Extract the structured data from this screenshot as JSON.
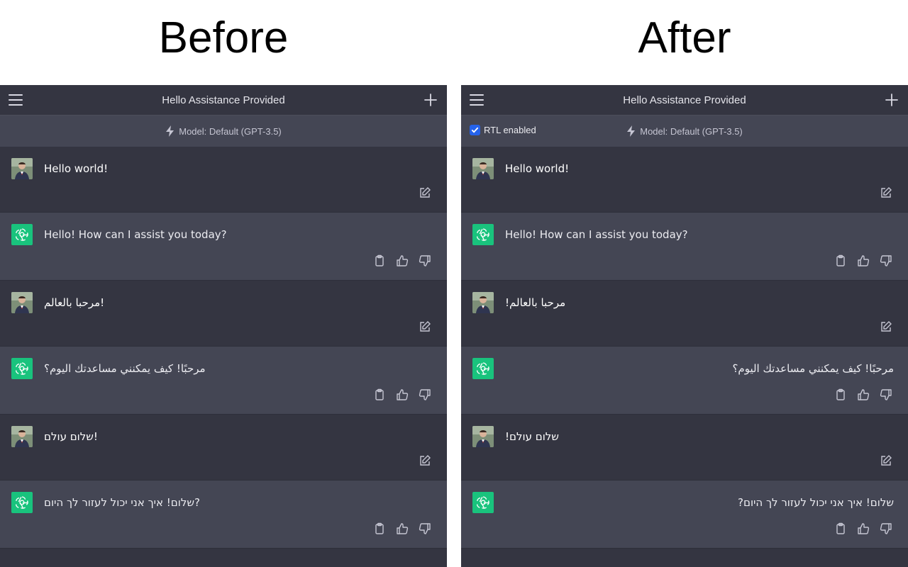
{
  "headings": {
    "before": "Before",
    "after": "After"
  },
  "panels": [
    {
      "id": "before",
      "title": "Hello Assistance Provided",
      "model": "Model: Default (GPT-3.5)",
      "rtl_toggle": null,
      "messages": [
        {
          "role": "user",
          "text": "Hello world!",
          "rtl": false
        },
        {
          "role": "assistant",
          "text": "Hello! How can I assist you today?",
          "rtl": false
        },
        {
          "role": "user",
          "text": "مرحبا بالعالم!",
          "rtl": false
        },
        {
          "role": "assistant",
          "text": "مرحبًا! كيف يمكنني مساعدتك اليوم؟",
          "rtl": false
        },
        {
          "role": "user",
          "text": "שלום עולם!",
          "rtl": false
        },
        {
          "role": "assistant",
          "text": "שלום! איך אני יכול לעזור לך היום?",
          "rtl": false
        }
      ]
    },
    {
      "id": "after",
      "title": "Hello Assistance Provided",
      "model": "Model: Default (GPT-3.5)",
      "rtl_toggle": "RTL enabled",
      "messages": [
        {
          "role": "user",
          "text": "Hello world!",
          "rtl": false
        },
        {
          "role": "assistant",
          "text": "Hello! How can I assist you today?",
          "rtl": false
        },
        {
          "role": "user",
          "text": "مرحبا بالعالم!",
          "rtl": true
        },
        {
          "role": "assistant",
          "text": "مرحبًا! كيف يمكنني مساعدتك اليوم؟",
          "rtl": true
        },
        {
          "role": "user",
          "text": "שלום עולם!",
          "rtl": true
        },
        {
          "role": "assistant",
          "text": "שלום! איך אני יכול לעזור לך היום?",
          "rtl": true
        }
      ]
    }
  ],
  "colors": {
    "background": "#343541",
    "assistant_row": "#444654",
    "gpt_avatar": "#19c37d",
    "rtl_checkbox": "#2563eb"
  },
  "icons": {
    "menu": "hamburger-menu-icon",
    "new_chat": "plus-icon",
    "model": "lightning-bolt-icon",
    "edit": "edit-pencil-icon",
    "copy": "clipboard-icon",
    "thumbs_up": "thumbs-up-icon",
    "thumbs_down": "thumbs-down-icon"
  }
}
